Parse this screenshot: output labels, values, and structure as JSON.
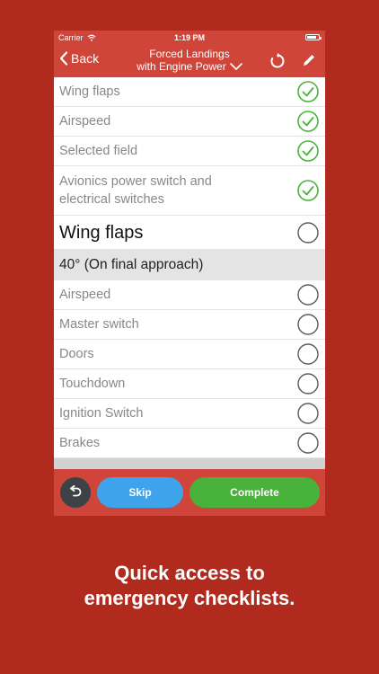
{
  "status_bar": {
    "carrier": "Carrier",
    "time": "1:19 PM"
  },
  "nav": {
    "back_label": "Back",
    "title_line1": "Forced Landings",
    "title_line2": "with Engine Power"
  },
  "checklist": {
    "completed_items": [
      {
        "label": "Wing flaps",
        "checked": true
      },
      {
        "label": "Airspeed",
        "checked": true
      },
      {
        "label": "Selected field",
        "checked": true
      },
      {
        "label": "Avionics power switch and electrical switches",
        "checked": true
      }
    ],
    "current_item": {
      "label": "Wing flaps",
      "checked": false
    },
    "section_header": "40° (On final approach)",
    "pending_items": [
      {
        "label": "Airspeed",
        "checked": false
      },
      {
        "label": "Master switch",
        "checked": false
      },
      {
        "label": "Doors",
        "checked": false
      },
      {
        "label": "Touchdown",
        "checked": false
      },
      {
        "label": "Ignition Switch",
        "checked": false
      },
      {
        "label": "Brakes",
        "checked": false
      }
    ]
  },
  "bottom_bar": {
    "skip_label": "Skip",
    "complete_label": "Complete"
  },
  "caption": {
    "line1": "Quick access to",
    "line2": "emergency checklists."
  },
  "colors": {
    "background": "#b02a1e",
    "accent": "#d0453a",
    "check_green": "#48b23a",
    "skip_blue": "#3fa3ec",
    "undo_gray": "#3e4246"
  },
  "icons": {
    "back": "chevron-left-icon",
    "dropdown": "chevron-down-icon",
    "reset": "refresh-icon",
    "edit": "pencil-icon",
    "undo": "undo-icon",
    "wifi": "wifi-icon",
    "battery": "battery-icon",
    "checked": "check-circle-icon",
    "unchecked": "empty-circle-icon"
  }
}
